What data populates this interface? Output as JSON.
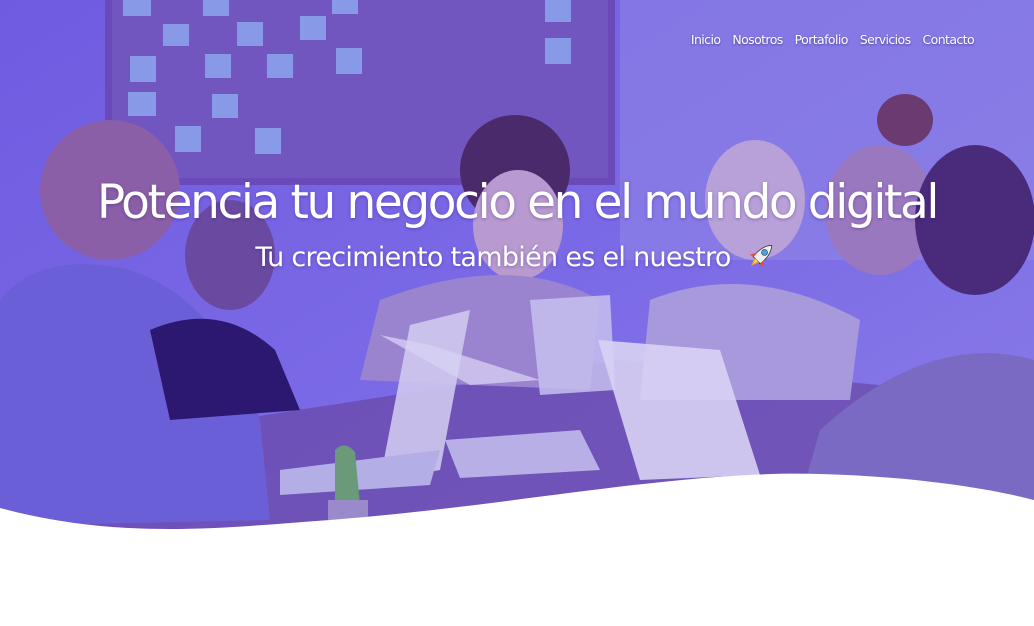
{
  "nav": {
    "items": [
      {
        "label": "Inicio"
      },
      {
        "label": "Nosotros"
      },
      {
        "label": "Portafolio"
      },
      {
        "label": "Servicios"
      },
      {
        "label": "Contacto"
      }
    ]
  },
  "hero": {
    "title": "Potencia tu negocio en el mundo digital",
    "subtitle": "Tu crecimiento también es el nuestro",
    "subtitle_icon": "rocket-icon",
    "overlay_color": "#6a4be8",
    "wave_color": "#ffffff",
    "background_image": "team-meeting-photo"
  }
}
